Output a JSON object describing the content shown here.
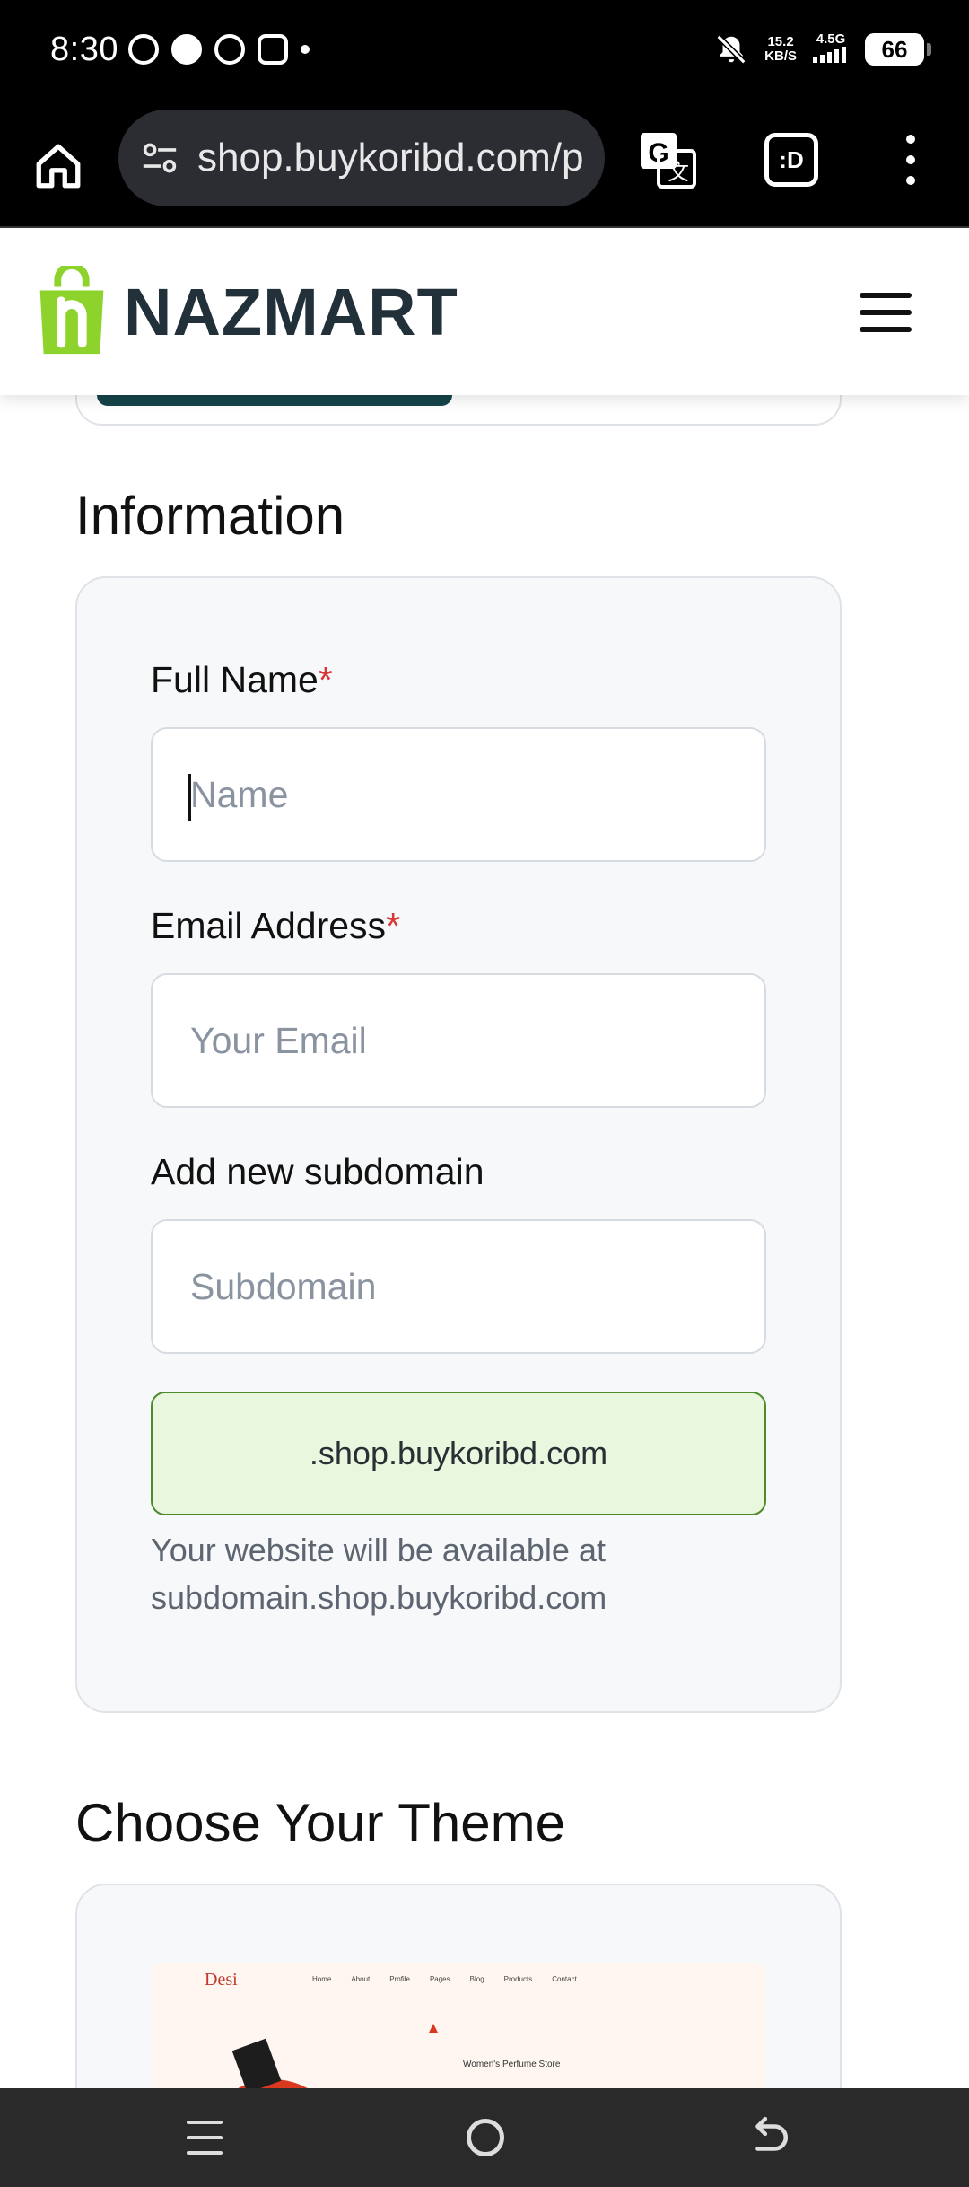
{
  "status_bar": {
    "time": "8:30",
    "net_speed_value": "15.2",
    "net_speed_unit": "KB/S",
    "network": "4.5G",
    "battery": "66"
  },
  "browser": {
    "url": "shop.buykoribd.com/p",
    "icons": [
      "home-icon",
      "site-settings-icon",
      "translate-icon",
      "reader-mode-icon",
      "overflow-menu-icon"
    ],
    "reader_label": ":D"
  },
  "site": {
    "brand": "NAZMART",
    "brand_color": "#8ed22c",
    "accent_dark": "#15444a"
  },
  "information": {
    "title": "Information",
    "full_name": {
      "label": "Full Name",
      "required_mark": "*",
      "placeholder": "Name",
      "value": ""
    },
    "email": {
      "label": "Email Address",
      "required_mark": "*",
      "placeholder": "Your Email",
      "value": ""
    },
    "subdomain": {
      "label": "Add new subdomain",
      "placeholder": "Subdomain",
      "value": ""
    },
    "domain_suffix": ".shop.buykoribd.com",
    "help_line1": "Your website will be available at",
    "help_line2": "subdomain.shop.buykoribd.com"
  },
  "theme": {
    "title": "Choose Your Theme",
    "preview": {
      "logo": "Desi",
      "nav": [
        "Home",
        "About",
        "Profile",
        "Pages",
        "Blog",
        "Products",
        "Contact"
      ],
      "subtitle": "Women's Perfume Store"
    }
  }
}
